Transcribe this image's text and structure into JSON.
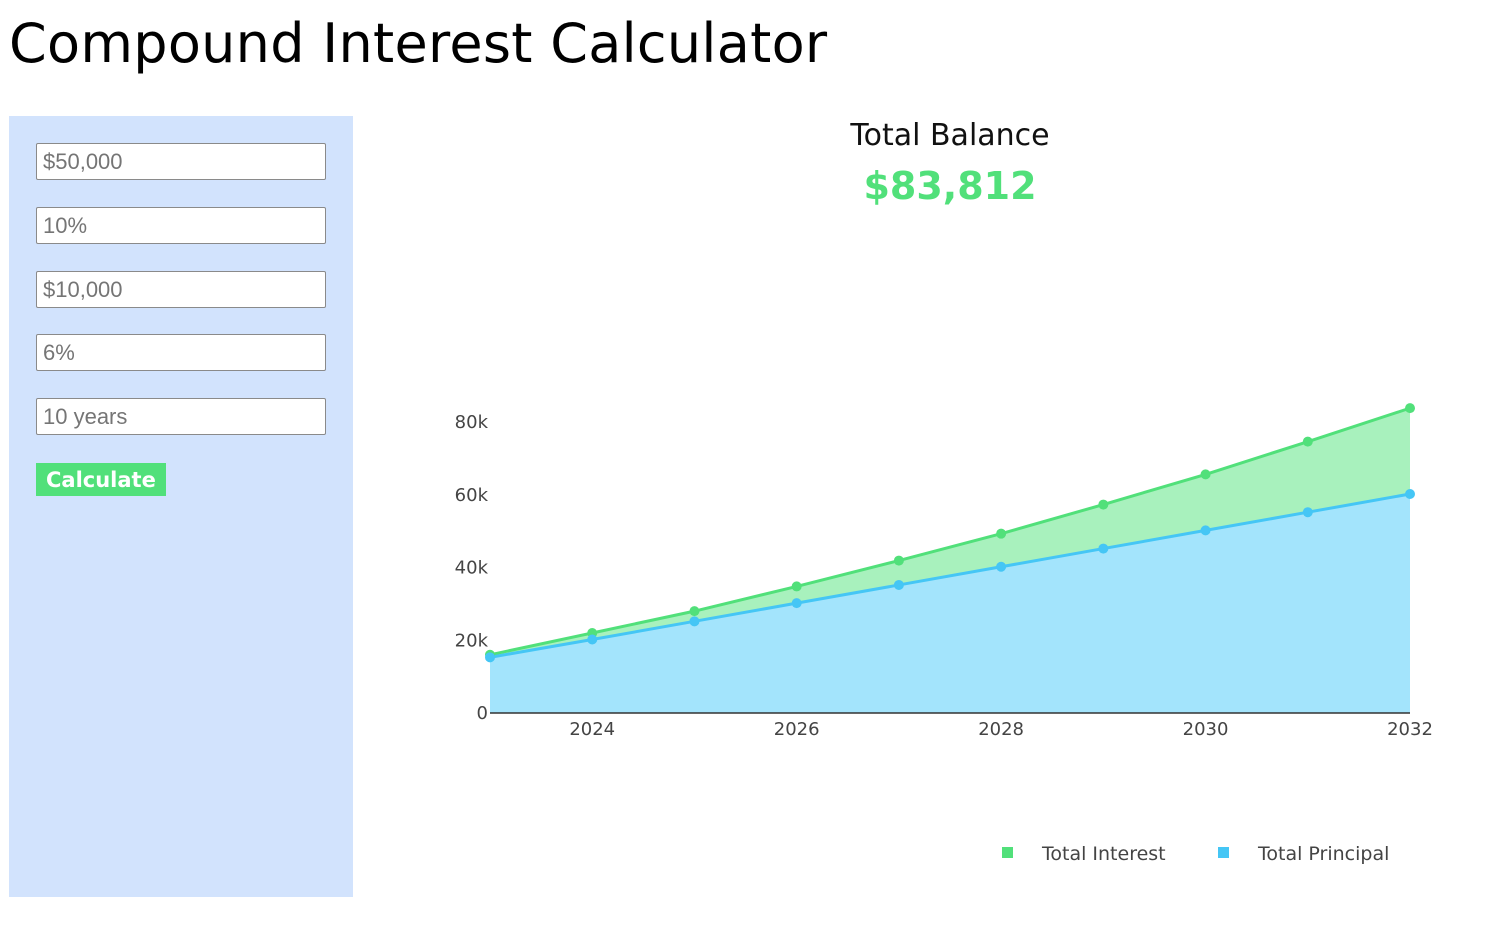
{
  "page": {
    "title": "Compound Interest Calculator"
  },
  "form": {
    "initial_investment_placeholder": "$50,000",
    "interest_rate_placeholder": "10%",
    "annual_contribution_placeholder": "$10,000",
    "contribution_growth_placeholder": "6%",
    "duration_placeholder": "10 years",
    "calculate_label": "Calculate"
  },
  "summary": {
    "label": "Total Balance",
    "value": "$83,812"
  },
  "colors": {
    "accent_green": "#51e07a",
    "interest_fill": "#a8f1bd",
    "principal_line": "#45c6f5",
    "principal_fill": "#a3e4fc",
    "sidebar_bg": "#d2e3fd"
  },
  "chart_data": {
    "type": "area",
    "x": [
      2023,
      2024,
      2025,
      2026,
      2027,
      2028,
      2029,
      2030,
      2031,
      2032
    ],
    "series": [
      {
        "name": "Total Interest",
        "color": "#51e07a",
        "values": [
          16000,
          22000,
          28000,
          34800,
          41900,
          49300,
          57300,
          65600,
          74600,
          83812
        ]
      },
      {
        "name": "Total Principal",
        "color": "#45c6f5",
        "values": [
          15300,
          20200,
          25200,
          30200,
          35200,
          40200,
          45200,
          50200,
          55200,
          60200
        ]
      }
    ],
    "x_ticks": [
      "2024",
      "2026",
      "2028",
      "2030",
      "2032"
    ],
    "y_ticks": [
      "0",
      "20k",
      "40k",
      "60k",
      "80k"
    ],
    "xlim": [
      2023,
      2032
    ],
    "ylim": [
      0,
      80000
    ],
    "grid": false,
    "legend_position": "bottom-right"
  }
}
